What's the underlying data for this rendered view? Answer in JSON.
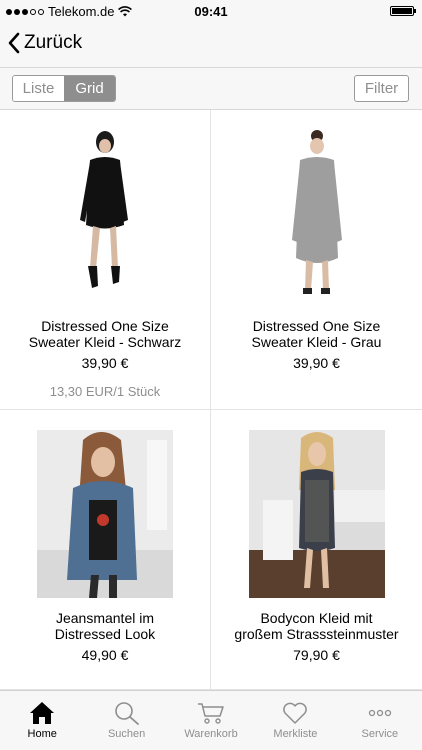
{
  "status_bar": {
    "carrier": "Telekom.de",
    "time": "09:41"
  },
  "nav": {
    "back_label": "Zurück"
  },
  "toolbar": {
    "view_options": [
      "Liste",
      "Grid"
    ],
    "active_view": "Grid",
    "filter_label": "Filter"
  },
  "products": [
    {
      "name_line1": "Distressed One Size",
      "name_line2": "Sweater Kleid - Schwarz",
      "price": "39,90 €",
      "unit_price": "13,30 EUR/1 Stück"
    },
    {
      "name_line1": "Distressed One Size",
      "name_line2": "Sweater Kleid - Grau",
      "price": "39,90 €",
      "unit_price": ""
    },
    {
      "name_line1": "Jeansmantel im",
      "name_line2": "Distressed Look",
      "price": "49,90 €",
      "unit_price": ""
    },
    {
      "name_line1": "Bodycon Kleid mit",
      "name_line2": "großem Strasssteinmuster",
      "price": "79,90 €",
      "unit_price": ""
    }
  ],
  "tabbar": {
    "items": [
      {
        "label": "Home",
        "icon": "home-icon",
        "active": true
      },
      {
        "label": "Suchen",
        "icon": "search-icon",
        "active": false
      },
      {
        "label": "Warenkorb",
        "icon": "cart-icon",
        "active": false
      },
      {
        "label": "Merkliste",
        "icon": "heart-icon",
        "active": false
      },
      {
        "label": "Service",
        "icon": "more-icon",
        "active": false
      }
    ]
  }
}
